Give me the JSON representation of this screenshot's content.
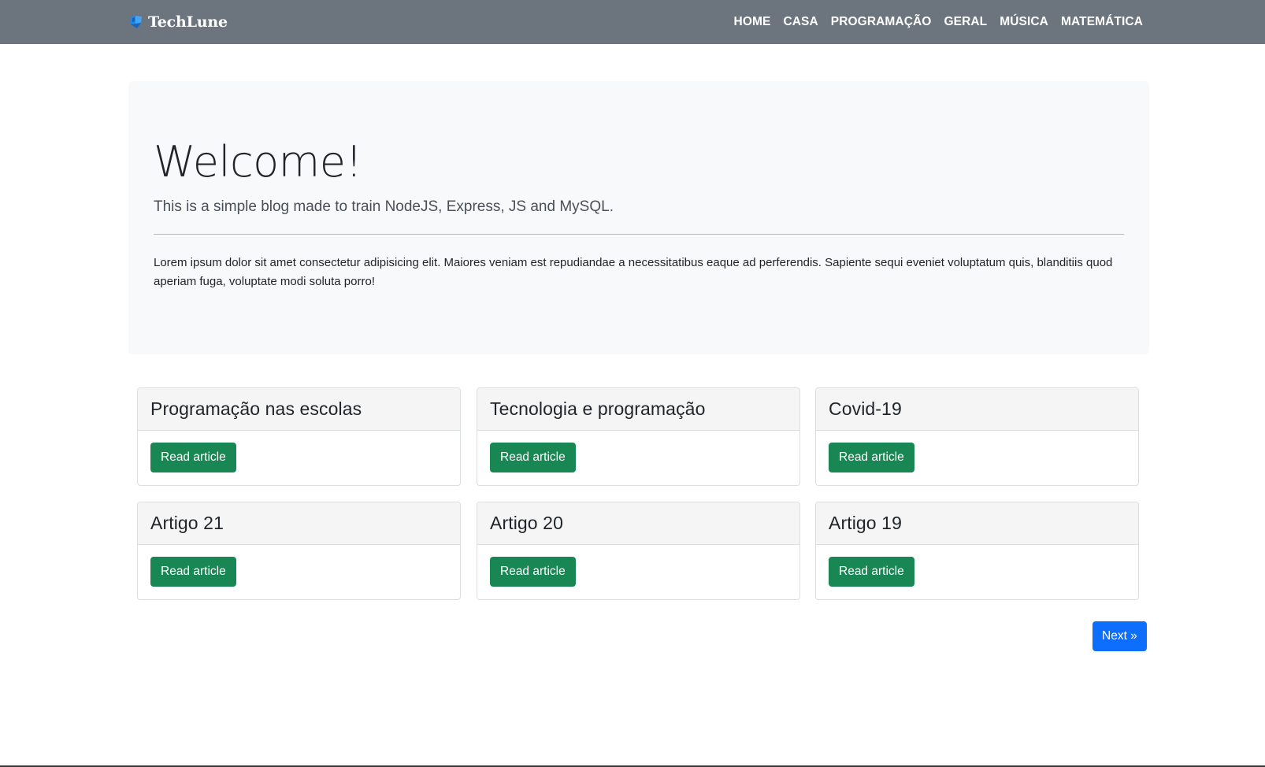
{
  "navbar": {
    "brand": "TechLune",
    "links": [
      "HOME",
      "CASA",
      "PROGRAMAÇÃO",
      "GERAL",
      "MÚSICA",
      "MATEMÁTICA"
    ]
  },
  "jumbotron": {
    "title": "Welcome!",
    "lead": "This is a simple blog made to train NodeJS, Express, JS and MySQL.",
    "text": "Lorem ipsum dolor sit amet consectetur adipisicing elit. Maiores veniam est repudiandae a necessitatibus eaque ad perferendis. Sapiente sequi eveniet voluptatum quis, blanditiis quod aperiam fuga, voluptate modi soluta porro!"
  },
  "articles": [
    {
      "title": "Programação nas escolas",
      "button": "Read article"
    },
    {
      "title": "Tecnologia e programação",
      "button": "Read article"
    },
    {
      "title": "Covid-19",
      "button": "Read article"
    },
    {
      "title": "Artigo 21",
      "button": "Read article"
    },
    {
      "title": "Artigo 20",
      "button": "Read article"
    },
    {
      "title": "Artigo 19",
      "button": "Read article"
    }
  ],
  "pagination": {
    "next_label": "Next »"
  },
  "colors": {
    "navbar_bg": "#6c757d",
    "jumbotron_bg": "#f8f9fa",
    "read_button": "#198754",
    "next_button": "#0d6efd",
    "brand_icon": "#1e88e5"
  },
  "icons": {
    "brand": "cube-logo-icon"
  }
}
